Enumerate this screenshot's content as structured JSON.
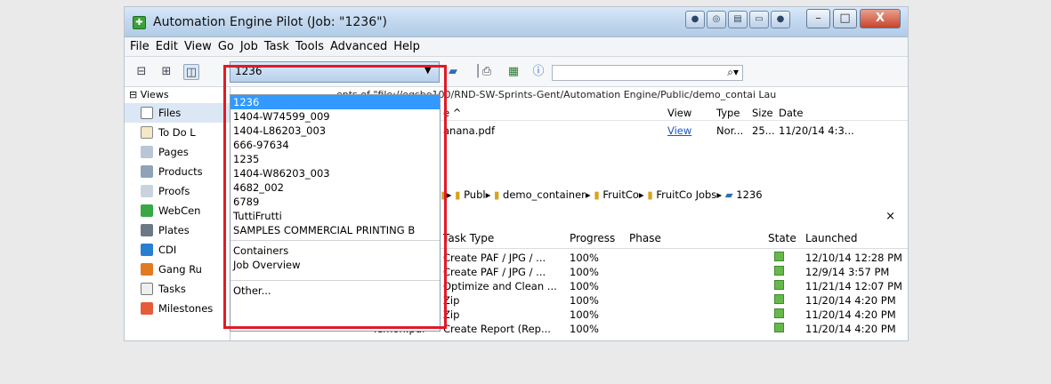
{
  "window": {
    "title": "Automation Engine Pilot (Job: \"1236\")",
    "close_glyph": "X"
  },
  "menu": [
    "File",
    "Edit",
    "View",
    "Go",
    "Job",
    "Task",
    "Tools",
    "Advanced",
    "Help"
  ],
  "toolbar": {
    "job_value": "1236",
    "search_value": "",
    "search_icon": "magnifier-icon"
  },
  "dropdown": {
    "items": [
      "1236",
      "1404-W74599_009",
      "1404-L86203_003",
      "666-97634",
      "1235",
      "1404-W86203_003",
      "4682_002",
      "6789",
      "TuttiFrutti",
      "SAMPLES COMMERCIAL PRINTING B"
    ],
    "extra": [
      "Containers",
      "Job Overview"
    ],
    "other": "Other..."
  },
  "views": {
    "header": "Views",
    "items": [
      "Files",
      "To Do L",
      "Pages",
      "Products",
      "Proofs",
      "WebCen",
      "Plates",
      "CDI",
      "Gang Ru",
      "Tasks",
      "Milestones"
    ]
  },
  "files": {
    "path_text": "ents of \"file://egsbe100/RND-SW-Sprints-Gent/Automation Engine/Public/demo_contai Lau",
    "header": {
      "name": "e ^",
      "view": "View",
      "type": "Type",
      "size": "Size",
      "date": "Date"
    },
    "row": {
      "name": "anana.pdf",
      "view": "View",
      "type": "Nor...",
      "size": "25...",
      "date": "11/20/14 4:3..."
    }
  },
  "breadcrumb": [
    "Publ",
    "demo_container",
    "FruitCo",
    "FruitCo Jobs",
    "1236"
  ],
  "tasks": {
    "header": {
      "task_type": "Task Type",
      "progress": "Progress",
      "phase": "Phase",
      "state": "State",
      "launched": "Launched"
    },
    "rows": [
      {
        "task": "Create PAF / JPG / ...",
        "progress": "100%",
        "launched": "12/10/14 12:28 PM",
        "name": ""
      },
      {
        "task": "Create PAF / JPG / ...",
        "progress": "100%",
        "launched": "12/9/14 3:57 PM",
        "name": ""
      },
      {
        "task": "Optimize and Clean ...",
        "progress": "100%",
        "launched": "11/21/14 12:07 PM",
        "name": ""
      },
      {
        "task": "Zip",
        "progress": "100%",
        "launched": "11/20/14 4:20 PM",
        "name": ""
      },
      {
        "task": "Zip",
        "progress": "100%",
        "launched": "11/20/14 4:20 PM",
        "name": ""
      },
      {
        "task": "Create Report (Rep...",
        "progress": "100%",
        "launched": "11/20/14 4:20 PM",
        "name": "lemon.pdf"
      }
    ]
  }
}
